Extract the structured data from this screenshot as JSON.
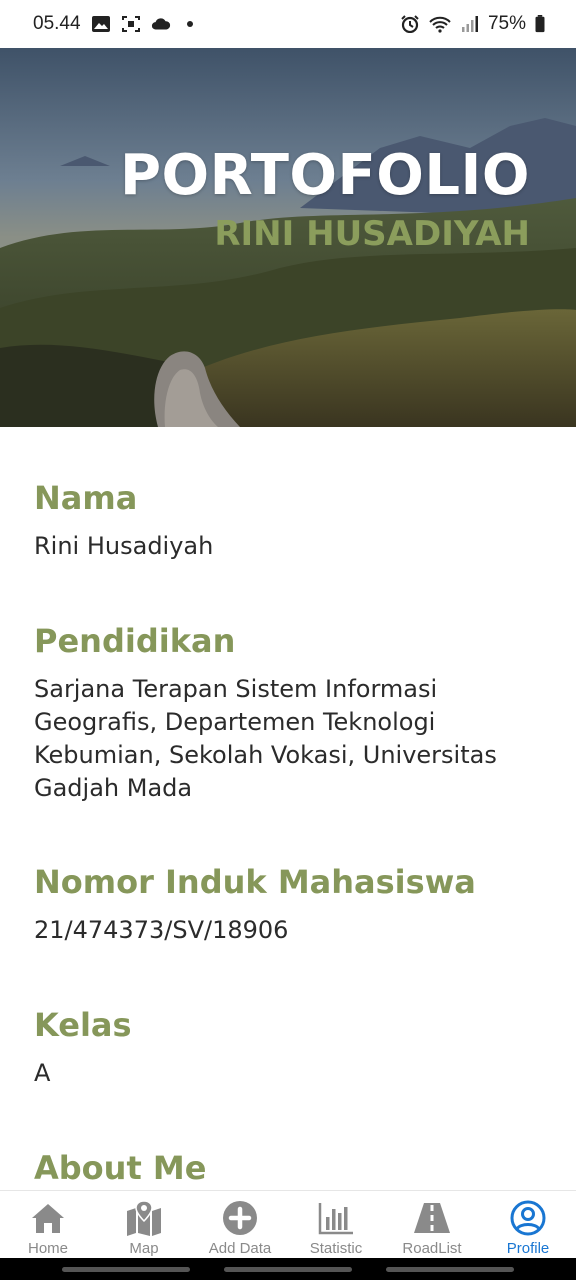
{
  "status_bar": {
    "time": "05.44",
    "battery": "75%"
  },
  "hero": {
    "title": "PORTOFOLIO",
    "subtitle": "RINI HUSADIYAH"
  },
  "sections": [
    {
      "title": "Nama",
      "value": "Rini Husadiyah"
    },
    {
      "title": "Pendidikan",
      "value": "Sarjana Terapan Sistem Informasi Geografis, Departemen Teknologi Kebumian, Sekolah Vokasi, Universitas Gadjah Mada"
    },
    {
      "title": "Nomor Induk Mahasiswa",
      "value": "21/474373/SV/18906"
    },
    {
      "title": "Kelas",
      "value": "A"
    },
    {
      "title": "About Me",
      "value": ""
    }
  ],
  "bottom_nav": {
    "items": [
      {
        "label": "Home",
        "icon": "home-icon"
      },
      {
        "label": "Map",
        "icon": "map-icon"
      },
      {
        "label": "Add Data",
        "icon": "add-circle-icon"
      },
      {
        "label": "Statistic",
        "icon": "bar-chart-icon"
      },
      {
        "label": "RoadList",
        "icon": "road-icon"
      },
      {
        "label": "Profile",
        "icon": "profile-icon"
      }
    ],
    "active_index": 5,
    "active_color": "#1976d2",
    "inactive_color": "#8a8a8a"
  },
  "colors": {
    "accent_olive": "#86975a"
  }
}
